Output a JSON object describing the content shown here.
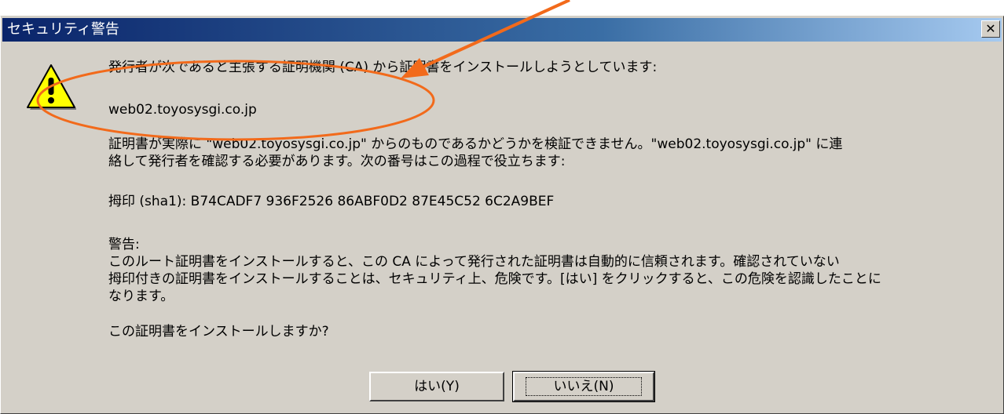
{
  "window": {
    "title": "セキュリティ警告",
    "close_glyph": "✕"
  },
  "message": {
    "line1": "発行者が次であると主張する証明機関 (CA) から証明書をインストールしようとしています:",
    "issuer": "web02.toyosysgi.co.jp",
    "verify_notice": "証明書が実際に \"web02.toyosysgi.co.jp\" からのものであるかどうかを検証できません。\"web02.toyosysgi.co.jp\" に連\n絡して発行者を確認する必要があります。次の番号はこの過程で役立ちます:",
    "thumbprint": "拇印 (sha1): B74CADF7 936F2526 86ABF0D2 87E45C52 6C2A9BEF",
    "warning_heading": "警告:",
    "warning_text": "このルート証明書をインストールすると、この CA によって発行された証明書は自動的に信頼されます。確認されていない\n拇印付きの証明書をインストールすることは、セキュリティ上、危険です。[はい] をクリックすると、この危険を認識したことに\nなります。",
    "question": "この証明書をインストールしますか?"
  },
  "buttons": {
    "yes": "はい(Y)",
    "no": "いいえ(N)"
  },
  "colors": {
    "titlebar_start": "#0a246a",
    "titlebar_end": "#a6caf0",
    "dialog_face": "#d4d0c8",
    "annotation": "#f26a1b"
  }
}
